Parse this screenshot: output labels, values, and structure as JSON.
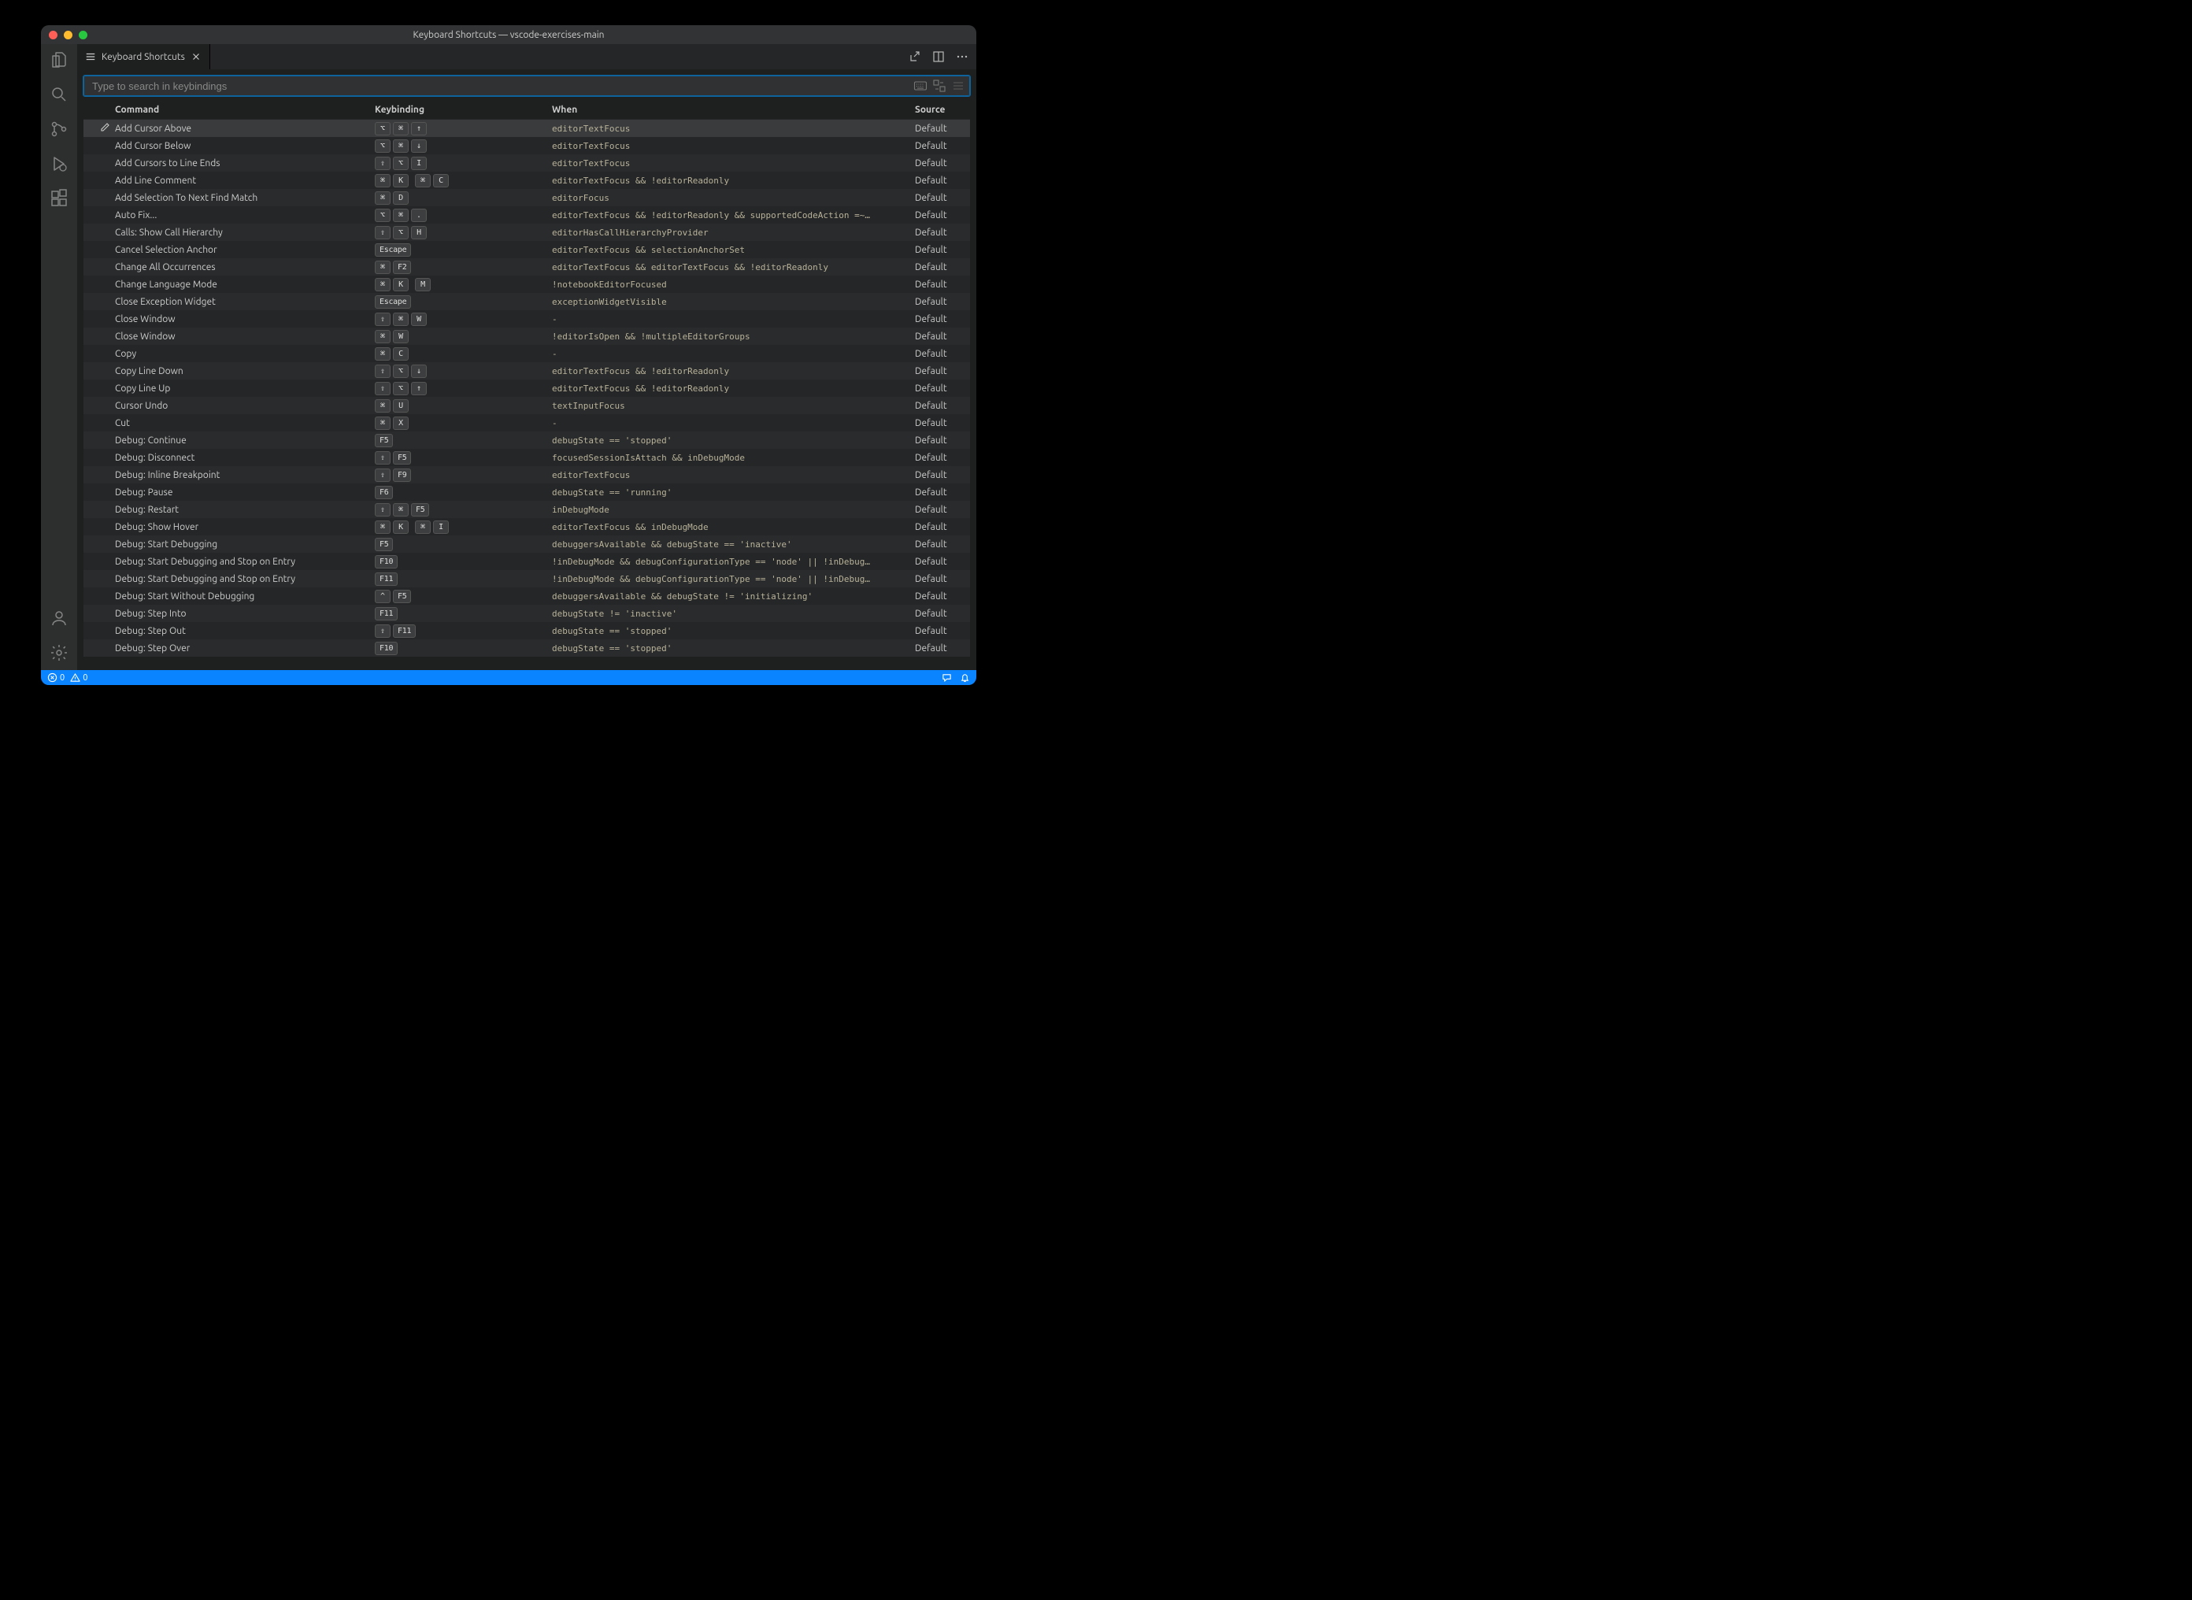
{
  "window": {
    "title": "Keyboard Shortcuts — vscode-exercises-main"
  },
  "tab": {
    "label": "Keyboard Shortcuts"
  },
  "search": {
    "placeholder": "Type to search in keybindings"
  },
  "headers": {
    "command": "Command",
    "keybinding": "Keybinding",
    "when": "When",
    "source": "Source"
  },
  "source_default": "Default",
  "keybindings": [
    {
      "command": "Add Cursor Above",
      "keys": [
        [
          "⌥",
          "⌘",
          "↑"
        ]
      ],
      "when": "editorTextFocus",
      "selected": true
    },
    {
      "command": "Add Cursor Below",
      "keys": [
        [
          "⌥",
          "⌘",
          "↓"
        ]
      ],
      "when": "editorTextFocus"
    },
    {
      "command": "Add Cursors to Line Ends",
      "keys": [
        [
          "⇧",
          "⌥",
          "I"
        ]
      ],
      "when": "editorTextFocus"
    },
    {
      "command": "Add Line Comment",
      "keys": [
        [
          "⌘",
          "K"
        ],
        [
          "⌘",
          "C"
        ]
      ],
      "when": "editorTextFocus && !editorReadonly"
    },
    {
      "command": "Add Selection To Next Find Match",
      "keys": [
        [
          "⌘",
          "D"
        ]
      ],
      "when": "editorFocus"
    },
    {
      "command": "Auto Fix...",
      "keys": [
        [
          "⌥",
          "⌘",
          "."
        ]
      ],
      "when": "editorTextFocus && !editorReadonly && supportedCodeAction =~…"
    },
    {
      "command": "Calls: Show Call Hierarchy",
      "keys": [
        [
          "⇧",
          "⌥",
          "H"
        ]
      ],
      "when": "editorHasCallHierarchyProvider"
    },
    {
      "command": "Cancel Selection Anchor",
      "keys": [
        [
          "Escape"
        ]
      ],
      "when": "editorTextFocus && selectionAnchorSet"
    },
    {
      "command": "Change All Occurrences",
      "keys": [
        [
          "⌘",
          "F2"
        ]
      ],
      "when": "editorTextFocus && editorTextFocus && !editorReadonly"
    },
    {
      "command": "Change Language Mode",
      "keys": [
        [
          "⌘",
          "K"
        ],
        [
          "M"
        ]
      ],
      "when": "!notebookEditorFocused"
    },
    {
      "command": "Close Exception Widget",
      "keys": [
        [
          "Escape"
        ]
      ],
      "when": "exceptionWidgetVisible"
    },
    {
      "command": "Close Window",
      "keys": [
        [
          "⇧",
          "⌘",
          "W"
        ]
      ],
      "when": "-"
    },
    {
      "command": "Close Window",
      "keys": [
        [
          "⌘",
          "W"
        ]
      ],
      "when": "!editorIsOpen && !multipleEditorGroups"
    },
    {
      "command": "Copy",
      "keys": [
        [
          "⌘",
          "C"
        ]
      ],
      "when": "-"
    },
    {
      "command": "Copy Line Down",
      "keys": [
        [
          "⇧",
          "⌥",
          "↓"
        ]
      ],
      "when": "editorTextFocus && !editorReadonly"
    },
    {
      "command": "Copy Line Up",
      "keys": [
        [
          "⇧",
          "⌥",
          "↑"
        ]
      ],
      "when": "editorTextFocus && !editorReadonly"
    },
    {
      "command": "Cursor Undo",
      "keys": [
        [
          "⌘",
          "U"
        ]
      ],
      "when": "textInputFocus"
    },
    {
      "command": "Cut",
      "keys": [
        [
          "⌘",
          "X"
        ]
      ],
      "when": "-"
    },
    {
      "command": "Debug: Continue",
      "keys": [
        [
          "F5"
        ]
      ],
      "when": "debugState == 'stopped'"
    },
    {
      "command": "Debug: Disconnect",
      "keys": [
        [
          "⇧",
          "F5"
        ]
      ],
      "when": "focusedSessionIsAttach && inDebugMode"
    },
    {
      "command": "Debug: Inline Breakpoint",
      "keys": [
        [
          "⇧",
          "F9"
        ]
      ],
      "when": "editorTextFocus"
    },
    {
      "command": "Debug: Pause",
      "keys": [
        [
          "F6"
        ]
      ],
      "when": "debugState == 'running'"
    },
    {
      "command": "Debug: Restart",
      "keys": [
        [
          "⇧",
          "⌘",
          "F5"
        ]
      ],
      "when": "inDebugMode"
    },
    {
      "command": "Debug: Show Hover",
      "keys": [
        [
          "⌘",
          "K"
        ],
        [
          "⌘",
          "I"
        ]
      ],
      "when": "editorTextFocus && inDebugMode"
    },
    {
      "command": "Debug: Start Debugging",
      "keys": [
        [
          "F5"
        ]
      ],
      "when": "debuggersAvailable && debugState == 'inactive'"
    },
    {
      "command": "Debug: Start Debugging and Stop on Entry",
      "keys": [
        [
          "F10"
        ]
      ],
      "when": "!inDebugMode && debugConfigurationType == 'node' || !inDebug…"
    },
    {
      "command": "Debug: Start Debugging and Stop on Entry",
      "keys": [
        [
          "F11"
        ]
      ],
      "when": "!inDebugMode && debugConfigurationType == 'node' || !inDebug…"
    },
    {
      "command": "Debug: Start Without Debugging",
      "keys": [
        [
          "^",
          "F5"
        ]
      ],
      "when": "debuggersAvailable && debugState != 'initializing'"
    },
    {
      "command": "Debug: Step Into",
      "keys": [
        [
          "F11"
        ]
      ],
      "when": "debugState != 'inactive'"
    },
    {
      "command": "Debug: Step Out",
      "keys": [
        [
          "⇧",
          "F11"
        ]
      ],
      "when": "debugState == 'stopped'"
    },
    {
      "command": "Debug: Step Over",
      "keys": [
        [
          "F10"
        ]
      ],
      "when": "debugState == 'stopped'"
    }
  ],
  "status": {
    "errors": "0",
    "warnings": "0"
  }
}
